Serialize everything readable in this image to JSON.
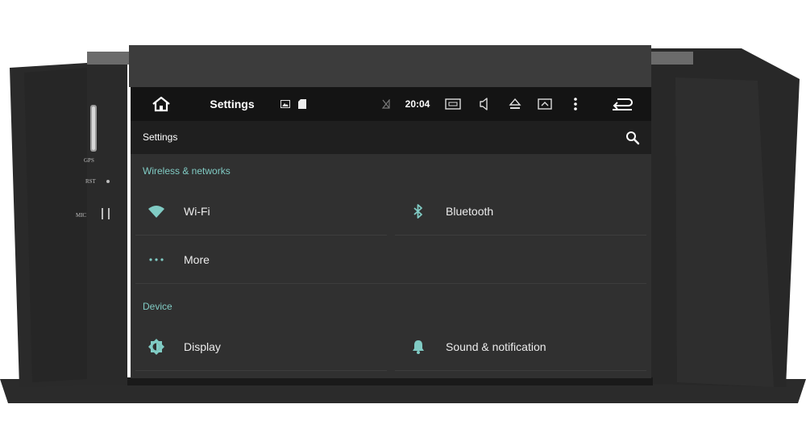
{
  "statusbar": {
    "title": "Settings",
    "time": "20:04"
  },
  "appbar": {
    "title": "Settings"
  },
  "panel": {
    "gps_label": "GPS",
    "rst_label": "RST",
    "mic_label": "MIC"
  },
  "sections": [
    {
      "header": "Wireless & networks",
      "items": [
        {
          "label": "Wi-Fi",
          "icon": "wifi-icon"
        },
        {
          "label": "Bluetooth",
          "icon": "bluetooth-icon"
        },
        {
          "label": "More",
          "icon": "more-dots-icon"
        }
      ]
    },
    {
      "header": "Device",
      "items": [
        {
          "label": "Display",
          "icon": "brightness-icon"
        },
        {
          "label": "Sound & notification",
          "icon": "bell-icon"
        }
      ]
    }
  ],
  "colors": {
    "accent": "#80cbc4",
    "background": "#303030",
    "statusbar": "#141414",
    "appbar": "#1f1f1f"
  }
}
